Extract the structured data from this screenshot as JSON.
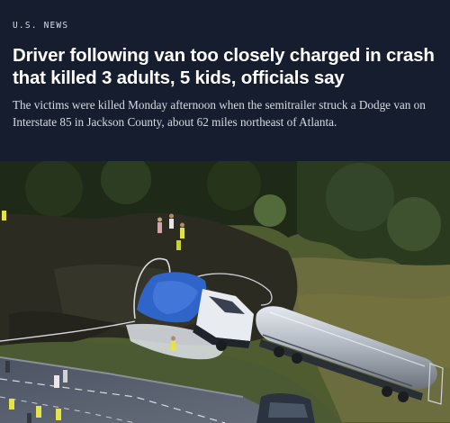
{
  "article": {
    "section_label": "U.S. NEWS",
    "headline": "Driver following van too closely charged in crash that killed 3 adults, 5 kids, officials say",
    "dek": "The victims were killed Monday afternoon when the semitrailer struck a Dodge van on Interstate 85 in Jackson County, about 62 miles northeast of Atlanta."
  },
  "photo": {
    "subject": "aerial-crash-scene",
    "colors": {
      "header_bg": "#151d2e",
      "grass": "#4a5a30",
      "scorched": "#2b2a23",
      "road": "#5a6170",
      "tarp": "#2f64c8",
      "tanker": "#aeb6c0"
    }
  }
}
